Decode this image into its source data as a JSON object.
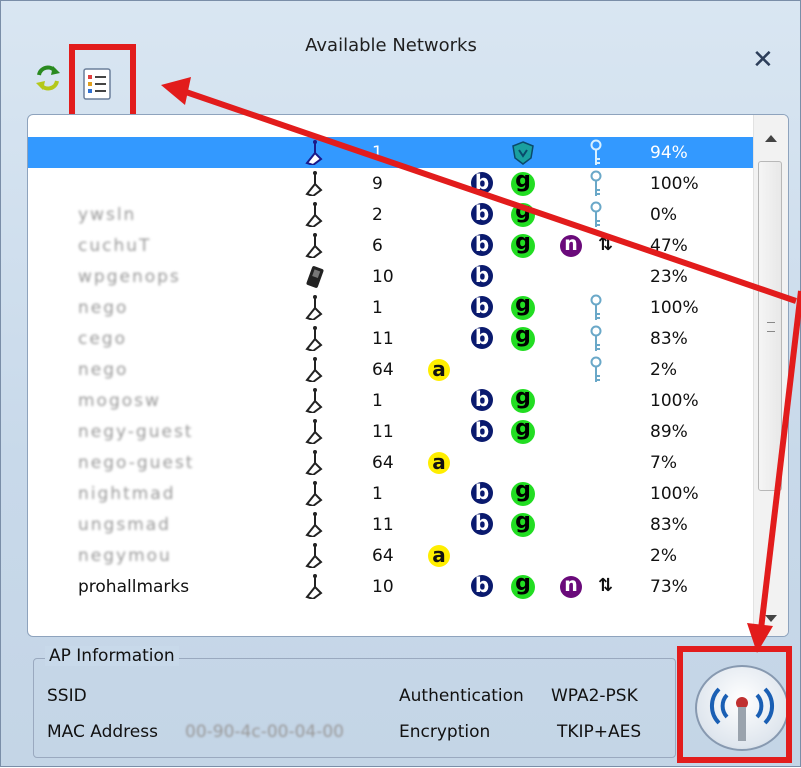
{
  "window": {
    "title": "Available Networks",
    "close_label": "✕"
  },
  "toolbar": {
    "refresh_icon": "refresh-icon",
    "list_icon": "list-view-icon"
  },
  "networks": [
    {
      "ssid": "",
      "blurred": false,
      "device": "ap",
      "channel": "1",
      "bands": [
        "g-shield"
      ],
      "dir": false,
      "key": true,
      "signal": "94%",
      "selected": true
    },
    {
      "ssid": "",
      "blurred": false,
      "device": "ap",
      "channel": "9",
      "bands": [
        "b",
        "g"
      ],
      "dir": false,
      "key": true,
      "signal": "100%"
    },
    {
      "ssid": "ywsln",
      "blurred": true,
      "device": "ap",
      "channel": "2",
      "bands": [
        "b",
        "g"
      ],
      "dir": false,
      "key": true,
      "signal": "0%"
    },
    {
      "ssid": "cuchuT",
      "blurred": true,
      "device": "ap",
      "channel": "6",
      "bands": [
        "b",
        "g",
        "n"
      ],
      "dir": true,
      "key": false,
      "signal": "47%"
    },
    {
      "ssid": "wpgenops",
      "blurred": true,
      "device": "phone",
      "channel": "10",
      "bands": [
        "b"
      ],
      "dir": false,
      "key": false,
      "signal": "23%"
    },
    {
      "ssid": "nego",
      "blurred": true,
      "device": "ap",
      "channel": "1",
      "bands": [
        "b",
        "g"
      ],
      "dir": false,
      "key": true,
      "signal": "100%"
    },
    {
      "ssid": "cego",
      "blurred": true,
      "device": "ap",
      "channel": "11",
      "bands": [
        "b",
        "g"
      ],
      "dir": false,
      "key": true,
      "signal": "83%"
    },
    {
      "ssid": "nego",
      "blurred": true,
      "device": "ap",
      "channel": "64",
      "bands": [
        "a"
      ],
      "dir": false,
      "key": true,
      "signal": "2%"
    },
    {
      "ssid": "mogosw",
      "blurred": true,
      "device": "ap",
      "channel": "1",
      "bands": [
        "b",
        "g"
      ],
      "dir": false,
      "key": false,
      "signal": "100%"
    },
    {
      "ssid": "negy-guest",
      "blurred": true,
      "device": "ap",
      "channel": "11",
      "bands": [
        "b",
        "g"
      ],
      "dir": false,
      "key": false,
      "signal": "89%"
    },
    {
      "ssid": "nego-guest",
      "blurred": true,
      "device": "ap",
      "channel": "64",
      "bands": [
        "a"
      ],
      "dir": false,
      "key": false,
      "signal": "7%"
    },
    {
      "ssid": "nightmad",
      "blurred": true,
      "device": "ap",
      "channel": "1",
      "bands": [
        "b",
        "g"
      ],
      "dir": false,
      "key": false,
      "signal": "100%"
    },
    {
      "ssid": "ungsmad",
      "blurred": true,
      "device": "ap",
      "channel": "11",
      "bands": [
        "b",
        "g"
      ],
      "dir": false,
      "key": false,
      "signal": "83%"
    },
    {
      "ssid": "negymou",
      "blurred": true,
      "device": "ap",
      "channel": "64",
      "bands": [
        "a"
      ],
      "dir": false,
      "key": false,
      "signal": "2%"
    },
    {
      "ssid": "prohallmarks",
      "blurred": false,
      "device": "ap",
      "channel": "10",
      "bands": [
        "b",
        "g",
        "n"
      ],
      "dir": true,
      "key": false,
      "signal": "73%"
    }
  ],
  "ap_info": {
    "group_label": "AP Information",
    "ssid_label": "SSID",
    "ssid_value": "",
    "mac_label": "MAC Address",
    "mac_value": "00-90-4c-00-04-00",
    "auth_label": "Authentication",
    "auth_value": "WPA2-PSK",
    "enc_label": "Encryption",
    "enc_value": "TKIP+AES"
  },
  "badges": {
    "a": "a",
    "b": "b",
    "g": "g",
    "n": "n",
    "dir": "⇅"
  },
  "colors": {
    "highlight": "#e21c1c",
    "selection": "#3399ff"
  }
}
